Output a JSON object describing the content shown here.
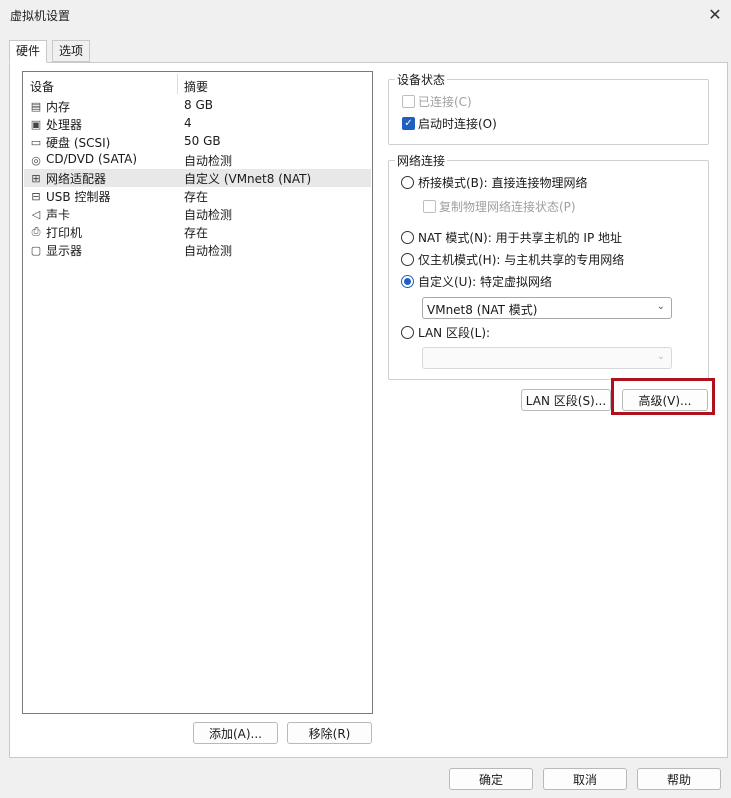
{
  "window": {
    "title": "虚拟机设置",
    "close_icon": "close-icon"
  },
  "tabs": [
    {
      "label": "硬件",
      "active": true
    },
    {
      "label": "选项",
      "active": false
    }
  ],
  "device_list": {
    "headers": {
      "device": "设备",
      "summary": "摘要"
    },
    "rows": [
      {
        "icon": "memory-icon",
        "name": "内存",
        "summary": "8 GB"
      },
      {
        "icon": "processor-icon",
        "name": "处理器",
        "summary": "4"
      },
      {
        "icon": "hard-disk-icon",
        "name": "硬盘 (SCSI)",
        "summary": "50 GB"
      },
      {
        "icon": "cd-dvd-icon",
        "name": "CD/DVD (SATA)",
        "summary": "自动检测"
      },
      {
        "icon": "network-adapter-icon",
        "name": "网络适配器",
        "summary": "自定义 (VMnet8 (NAT)",
        "selected": true
      },
      {
        "icon": "usb-icon",
        "name": "USB 控制器",
        "summary": "存在"
      },
      {
        "icon": "sound-card-icon",
        "name": "声卡",
        "summary": "自动检测"
      },
      {
        "icon": "printer-icon",
        "name": "打印机",
        "summary": "存在"
      },
      {
        "icon": "display-icon",
        "name": "显示器",
        "summary": "自动检测"
      }
    ],
    "add_button": "添加(A)...",
    "remove_button": "移除(R)"
  },
  "device_status": {
    "title": "设备状态",
    "connected": {
      "label": "已连接(C)",
      "checked": false,
      "disabled": true
    },
    "connect_at_power_on": {
      "label": "启动时连接(O)",
      "checked": true
    }
  },
  "network_connection": {
    "title": "网络连接",
    "bridged": {
      "label": "桥接模式(B): 直接连接物理网络",
      "checked": false
    },
    "replicate": {
      "label": "复制物理网络连接状态(P)",
      "checked": false,
      "disabled": true
    },
    "nat": {
      "label": "NAT 模式(N): 用于共享主机的 IP 地址",
      "checked": false
    },
    "host_only": {
      "label": "仅主机模式(H): 与主机共享的专用网络",
      "checked": false
    },
    "custom": {
      "label": "自定义(U): 特定虚拟网络",
      "checked": true
    },
    "custom_select": {
      "value": "VMnet8 (NAT 模式)"
    },
    "lan_segment": {
      "label": "LAN 区段(L):",
      "checked": false
    },
    "lan_select": {
      "value": ""
    }
  },
  "buttons": {
    "lan_segments": "LAN 区段(S)...",
    "advanced": "高级(V)...",
    "ok": "确定",
    "cancel": "取消",
    "help": "帮助"
  },
  "colors": {
    "accent": "#1f5fbf",
    "highlight_box": "#b0121d"
  }
}
